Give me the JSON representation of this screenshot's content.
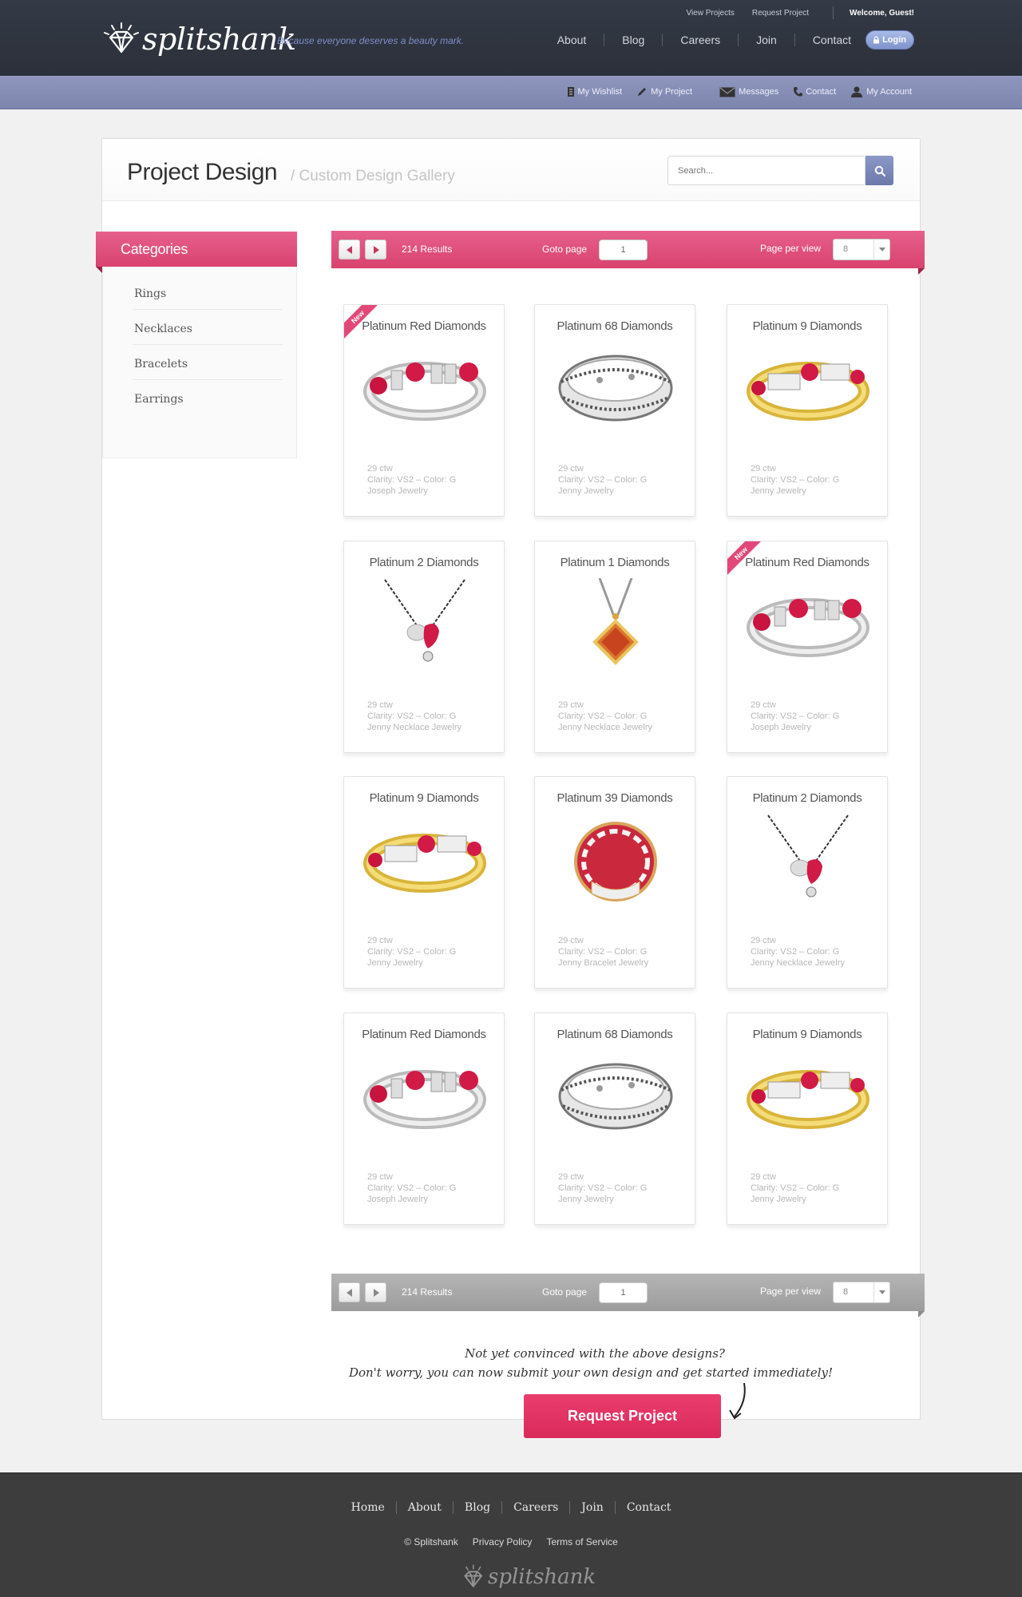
{
  "brand": {
    "name": "splitshank",
    "tagline": "Because everyone deserves a beauty mark."
  },
  "utility_nav": {
    "view_projects": "View Projects",
    "request_project": "Request Project",
    "welcome": "Welcome, Guest!"
  },
  "main_nav": [
    "About",
    "Blog",
    "Careers",
    "Join",
    "Contact"
  ],
  "login_label": "Login",
  "sub_nav": [
    {
      "label": "My Wishlist",
      "icon": "wishlist-icon"
    },
    {
      "label": "My Project",
      "icon": "pencil-icon"
    },
    {
      "label": "Messages",
      "icon": "envelope-icon"
    },
    {
      "label": "Contact",
      "icon": "phone-icon"
    },
    {
      "label": "My Account",
      "icon": "user-icon"
    }
  ],
  "page": {
    "title": "Project Design",
    "subtitle": "/ Custom Design Gallery",
    "search_placeholder": "Search..."
  },
  "categories": {
    "heading": "Categories",
    "items": [
      "Rings",
      "Necklaces",
      "Bracelets",
      "Earrings"
    ]
  },
  "pager": {
    "results": "214 Results",
    "goto_label": "Goto page",
    "goto_value": "1",
    "per_page_label": "Page per view",
    "per_page_value": "8"
  },
  "products": [
    {
      "title": "Platinum Red Diamonds",
      "ctw": "29 ctw",
      "clarity": "Clarity: VS2 – Color: G",
      "vendor": "Joseph Jewelry",
      "badge": "New",
      "image": "ring-ruby-silver"
    },
    {
      "title": "Platinum 68 Diamonds",
      "ctw": "29 ctw",
      "clarity": "Clarity: VS2 – Color: G",
      "vendor": "Jenny Jewelry",
      "badge": "",
      "image": "ring-band-silver"
    },
    {
      "title": "Platinum 9 Diamonds",
      "ctw": "29 ctw",
      "clarity": "Clarity: VS2 – Color: G",
      "vendor": "Jenny Jewelry",
      "badge": "",
      "image": "ring-ruby-gold"
    },
    {
      "title": "Platinum 2 Diamonds",
      "ctw": "29 ctw",
      "clarity": "Clarity: VS2 – Color: G",
      "vendor": "Jenny Necklace Jewelry",
      "badge": "",
      "image": "necklace-heart"
    },
    {
      "title": "Platinum 1 Diamonds",
      "ctw": "29 ctw",
      "clarity": "Clarity: VS2 – Color: G",
      "vendor": "Jenny Necklace Jewelry",
      "badge": "",
      "image": "necklace-pendant"
    },
    {
      "title": "Platinum Red Diamonds",
      "ctw": "29 ctw",
      "clarity": "Clarity: VS2 – Color: G",
      "vendor": "Joseph Jewelry",
      "badge": "New",
      "image": "ring-ruby-silver"
    },
    {
      "title": "Platinum 9 Diamonds",
      "ctw": "29 ctw",
      "clarity": "Clarity: VS2 – Color: G",
      "vendor": "Jenny Jewelry",
      "badge": "",
      "image": "ring-ruby-gold"
    },
    {
      "title": "Platinum 39 Diamonds",
      "ctw": "29 ctw",
      "clarity": "Clarity: VS2 – Color: G",
      "vendor": "Jenny Bracelet Jewelry",
      "badge": "",
      "image": "ring-enamel-red"
    },
    {
      "title": "Platinum 2 Diamonds",
      "ctw": "29 ctw",
      "clarity": "Clarity: VS2 – Color: G",
      "vendor": "Jenny Necklace Jewelry",
      "badge": "",
      "image": "necklace-heart"
    },
    {
      "title": "Platinum Red Diamonds",
      "ctw": "29 ctw",
      "clarity": "Clarity: VS2 – Color: G",
      "vendor": "Joseph Jewelry",
      "badge": "",
      "image": "ring-ruby-silver"
    },
    {
      "title": "Platinum 68 Diamonds",
      "ctw": "29 ctw",
      "clarity": "Clarity: VS2 – Color: G",
      "vendor": "Jenny Jewelry",
      "badge": "",
      "image": "ring-band-silver"
    },
    {
      "title": "Platinum 9 Diamonds",
      "ctw": "29 ctw",
      "clarity": "Clarity: VS2 – Color: G",
      "vendor": "Jenny Jewelry",
      "badge": "",
      "image": "ring-ruby-gold"
    }
  ],
  "cta": {
    "line1": "Not yet convinced with the above designs?",
    "line2": "Don't worry, you can now submit your own design and get started immediately!",
    "button": "Request Project"
  },
  "footer": {
    "nav": [
      "Home",
      "About",
      "Blog",
      "Careers",
      "Join",
      "Contact"
    ],
    "copyright": "© Splitshank",
    "privacy": "Privacy Policy",
    "terms": "Terms of Service",
    "logo_text": "splitshank"
  },
  "colors": {
    "accent_pink": "#d9426f",
    "header_dark": "#2b303a",
    "subbar_blue": "#7c85ad"
  }
}
